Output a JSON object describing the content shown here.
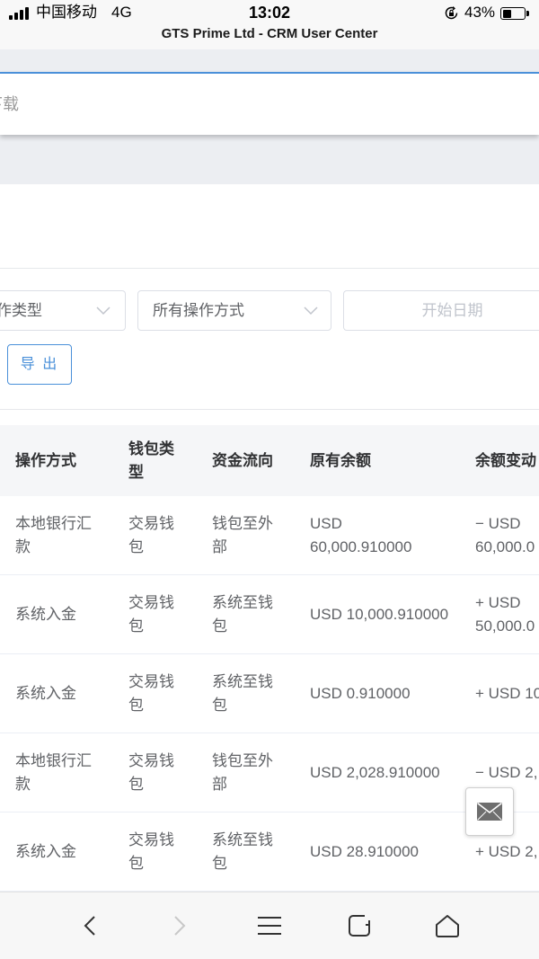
{
  "theme": {
    "accent": "#4a90d9",
    "table_header_bg": "#f5f6f8",
    "page_gray": "#eceef2"
  },
  "status_bar": {
    "carrier": "中国移动",
    "network": "4G",
    "time": "13:02",
    "battery_text": "43%",
    "battery_level": 0.43,
    "icons": [
      "signal-icon",
      "rotation-lock-icon",
      "battery-icon"
    ]
  },
  "browser": {
    "page_title": "GTS Prime Ltd - CRM User Center"
  },
  "menu_panel": {
    "item_label": "下载"
  },
  "filters": {
    "operation_type": "作类型",
    "operation_method": "所有操作方式",
    "start_date_placeholder": "开始日期",
    "export_label": "导 出",
    "dropdown_icon": "chevron-down-icon"
  },
  "table": {
    "headers": [
      "操作方式",
      "钱包类\n型",
      "资金流向",
      "原有余额",
      "余额变动"
    ],
    "rows": [
      {
        "method": "本地银行汇\n款",
        "wallet_type": "交易钱\n包",
        "flow": "钱包至外\n部",
        "original_balance": "USD\n60,000.910000",
        "balance_change": "− USD\n60,000.0"
      },
      {
        "method": "系统入金",
        "wallet_type": "交易钱\n包",
        "flow": "系统至钱\n包",
        "original_balance": "USD 10,000.910000",
        "balance_change": "+ USD\n50,000.0"
      },
      {
        "method": "系统入金",
        "wallet_type": "交易钱\n包",
        "flow": "系统至钱\n包",
        "original_balance": "USD 0.910000",
        "balance_change": "+ USD 10"
      },
      {
        "method": "本地银行汇\n款",
        "wallet_type": "交易钱\n包",
        "flow": "钱包至外\n部",
        "original_balance": "USD 2,028.910000",
        "balance_change": "− USD 2,"
      },
      {
        "method": "系统入金",
        "wallet_type": "交易钱\n包",
        "flow": "系统至钱\n包",
        "original_balance": "USD 28.910000",
        "balance_change": "+ USD 2,"
      }
    ]
  },
  "floating": {
    "icon": "mail-icon"
  },
  "bottom_nav": {
    "icons": [
      "back-icon",
      "forward-icon",
      "menu-icon",
      "tabs-icon",
      "home-icon"
    ]
  }
}
